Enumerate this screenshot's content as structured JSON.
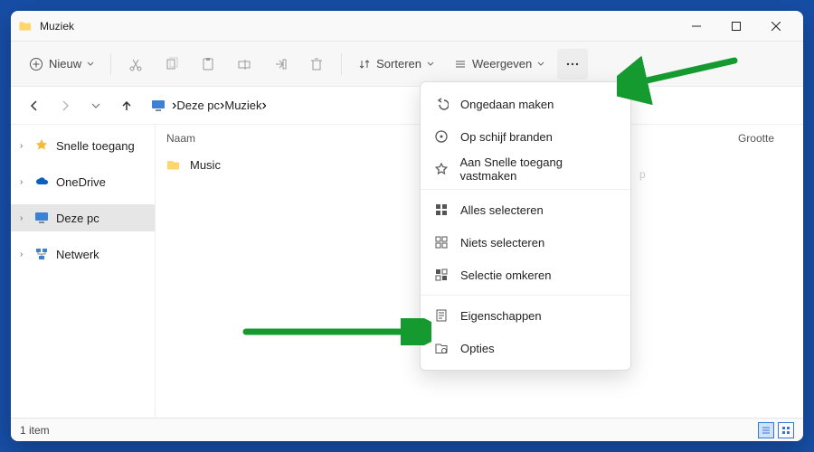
{
  "window": {
    "title": "Muziek"
  },
  "toolbar": {
    "new_label": "Nieuw",
    "sort_label": "Sorteren",
    "view_label": "Weergeven"
  },
  "breadcrumb": {
    "root": "Deze pc",
    "child": "Muziek"
  },
  "sidebar": {
    "items": [
      {
        "label": "Snelle toegang",
        "icon": "star"
      },
      {
        "label": "OneDrive",
        "icon": "cloud"
      },
      {
        "label": "Deze pc",
        "icon": "monitor"
      },
      {
        "label": "Netwerk",
        "icon": "network"
      }
    ]
  },
  "columns": {
    "name": "Naam",
    "size": "Grootte"
  },
  "files": [
    {
      "name": "Music"
    }
  ],
  "menu": {
    "undo": "Ongedaan maken",
    "burn": "Op schijf branden",
    "pin": "Aan Snelle toegang vastmaken",
    "selectall": "Alles selecteren",
    "selectnone": "Niets selecteren",
    "invert": "Selectie omkeren",
    "properties": "Eigenschappen",
    "options": "Opties"
  },
  "status": {
    "items": "1 item"
  },
  "hidden_text": {
    "type_col": "p"
  }
}
